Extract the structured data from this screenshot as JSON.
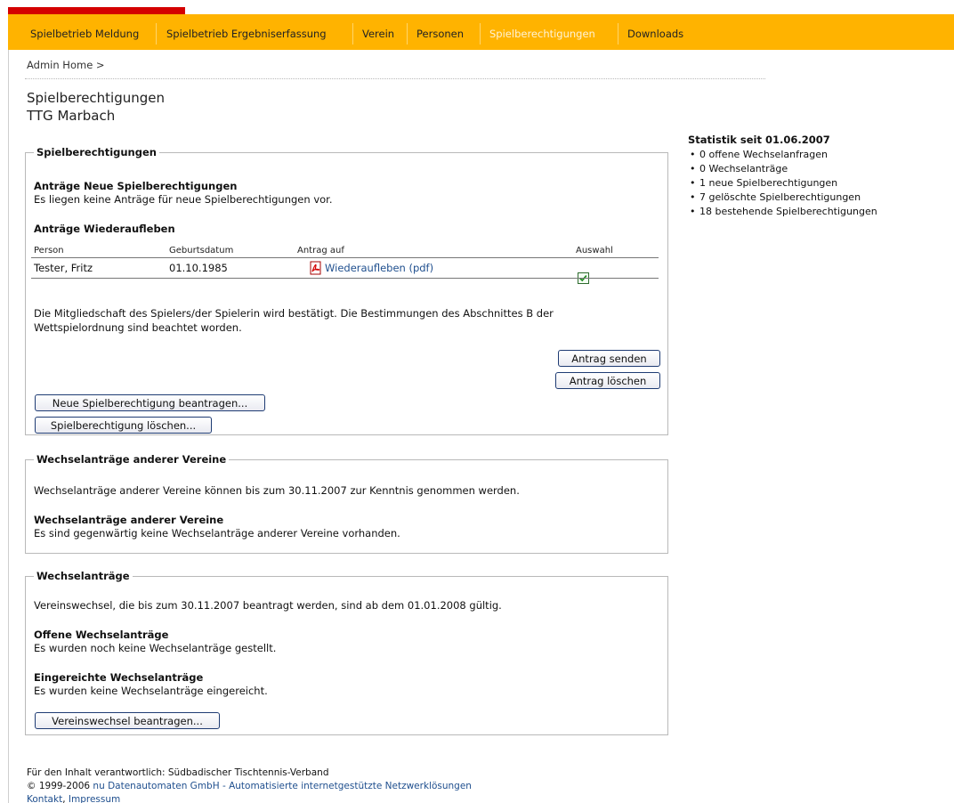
{
  "nav": {
    "items": [
      {
        "label": "Spielbetrieb Meldung"
      },
      {
        "label": "Spielbetrieb Ergebniserfassung"
      },
      {
        "label": "Verein"
      },
      {
        "label": "Personen"
      },
      {
        "label": "Spielberechtigungen",
        "active": true
      },
      {
        "label": "Downloads"
      }
    ]
  },
  "breadcrumb": "Admin Home >",
  "page": {
    "title": "Spielberechtigungen",
    "subtitle": "TTG Marbach"
  },
  "section1": {
    "legend": "Spielberechtigungen",
    "new_heading": "Anträge Neue Spielberechtigungen",
    "new_text": "Es liegen keine Anträge für neue Spielberechtigungen vor.",
    "revival_heading": "Anträge Wiederaufleben",
    "table": {
      "headers": [
        "Person",
        "Geburtsdatum",
        "Antrag auf",
        "Auswahl"
      ],
      "rows": [
        {
          "person": "Tester, Fritz",
          "birthdate": "01.10.1985",
          "request": "Wiederaufleben (pdf)",
          "selected": true
        }
      ]
    },
    "confirm_line1": "Die Mitgliedschaft des Spielers/der Spielerin wird bestätigt. Die Bestimmungen des Abschnittes B der",
    "confirm_line2": "Wettspielordnung sind beachtet worden.",
    "send_button": "Antrag senden",
    "delete_request_button": "Antrag löschen",
    "new_button": "Neue Spielberechtigung beantragen...",
    "delete_button": "Spielberechtigung löschen..."
  },
  "section2": {
    "legend": "Wechselanträge anderer Vereine",
    "info": "Wechselanträge anderer Vereine können bis zum 30.11.2007 zur Kenntnis genommen werden.",
    "heading": "Wechselanträge anderer Vereine",
    "text": "Es sind gegenwärtig keine Wechselanträge anderer Vereine vorhanden."
  },
  "section3": {
    "legend": "Wechselanträge",
    "info": "Vereinswechsel, die bis zum 30.11.2007 beantragt werden, sind ab dem 01.01.2008 gültig.",
    "open_heading": "Offene Wechselanträge",
    "open_text": "Es wurden noch keine Wechselanträge gestellt.",
    "submitted_heading": "Eingereichte Wechselanträge",
    "submitted_text": "Es wurden keine Wechselanträge eingereicht.",
    "button": "Vereinswechsel beantragen..."
  },
  "stats": {
    "title": "Statistik seit 01.06.2007",
    "items": [
      "0 offene Wechselanfragen",
      "0 Wechselanträge",
      "1 neue Spielberechtigungen",
      "7 gelöschte Spielberechtigungen",
      "18 bestehende Spielberechtigungen"
    ]
  },
  "footer": {
    "line1": "Für den Inhalt verantwortlich: Südbadischer Tischtennis-Verband",
    "copyright": "© 1999-2006",
    "company_link": "nu Datenautomaten GmbH - Automatisierte internetgestützte Netzwerklösungen",
    "contact_link": "Kontakt",
    "imprint_link": "Impressum"
  },
  "colors": {
    "nav_bg": "#ffb300",
    "top_bar": "#d40000",
    "link": "#1f4f8e"
  }
}
